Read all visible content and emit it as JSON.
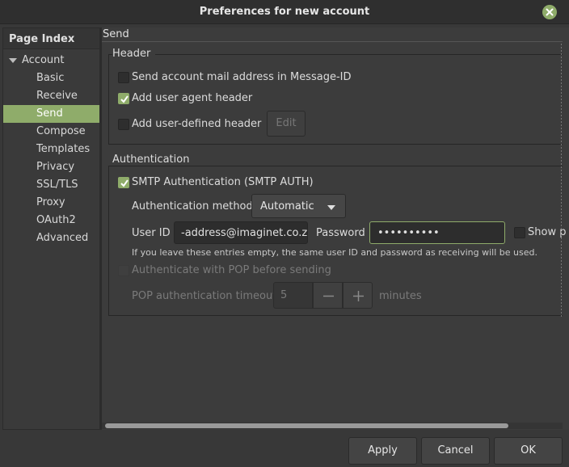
{
  "window": {
    "title": "Preferences for new account"
  },
  "page_index": {
    "title": "Page Index",
    "root": "Account",
    "items": [
      "Basic",
      "Receive",
      "Send",
      "Compose",
      "Templates",
      "Privacy",
      "SSL/TLS",
      "Proxy",
      "OAuth2",
      "Advanced"
    ],
    "selected": "Send"
  },
  "page": {
    "title": "Send",
    "header_section": {
      "label": "Header",
      "send_account_address": {
        "label": "Send account mail address in Message-ID",
        "checked": false
      },
      "add_user_agent": {
        "label": "Add user agent header",
        "checked": true
      },
      "add_user_defined": {
        "label": "Add user-defined header",
        "checked": false
      },
      "edit_button": "Edit"
    },
    "auth_section": {
      "label": "Authentication",
      "smtp_auth": {
        "label": "SMTP Authentication (SMTP AUTH)",
        "checked": true
      },
      "method_label": "Authentication method",
      "method_value": "Automatic",
      "user_id_label": "User ID",
      "user_id_value": "-address@imaginet.co.za",
      "password_label": "Password",
      "password_value": "••••••••••",
      "show_password_label": "Show p",
      "hint": "If you leave these entries empty, the same user ID and password as receiving will be used.",
      "pop_before": {
        "label": "Authenticate with POP before sending",
        "checked": false
      },
      "pop_timeout_label": "POP authentication timeout",
      "pop_timeout_value": "5",
      "minutes_label": "minutes"
    }
  },
  "buttons": {
    "apply": "Apply",
    "cancel": "Cancel",
    "ok": "OK"
  },
  "colors": {
    "accent": "#8fac6a",
    "background": "#383838"
  }
}
